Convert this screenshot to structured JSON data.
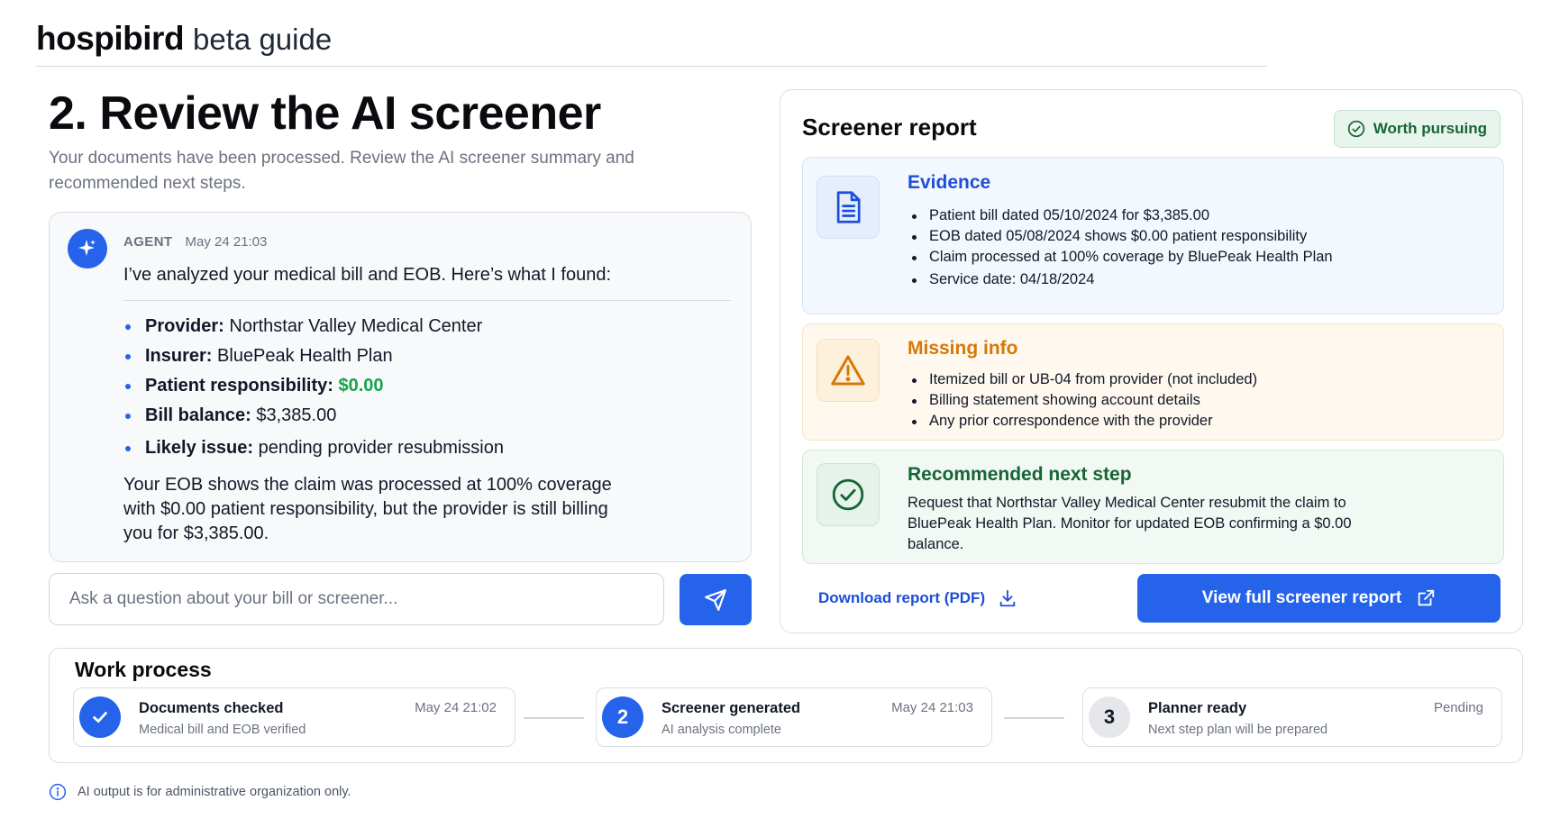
{
  "header": {
    "brand": "hospibird",
    "subtitle": "beta guide"
  },
  "page": {
    "title": "2. Review the AI screener",
    "subtitle": "Your documents have been processed. Review the AI screener summary and recommended next steps."
  },
  "agent": {
    "role": "AGENT",
    "time": "May 24 21:03",
    "intro": "I’ve analyzed your medical bill and EOB. Here’s what I found:",
    "items": [
      {
        "label": "Provider:",
        "value": "Northstar Valley Medical Center"
      },
      {
        "label": "Insurer:",
        "value": "BluePeak Health Plan"
      },
      {
        "label": "Patient responsibility:",
        "value": "$0.00"
      },
      {
        "label": "Bill balance:",
        "value": "$3,385.00"
      },
      {
        "label": "Likely issue:",
        "value": "pending provider resubmission"
      }
    ],
    "summary": "Your EOB shows the claim was processed at 100% coverage with $0.00 patient responsibility, but the provider is still billing you for $3,385.00."
  },
  "ask": {
    "placeholder": "Ask a question about your bill or screener..."
  },
  "report": {
    "title": "Screener report",
    "badge": "Worth pursuing",
    "evidence": {
      "heading": "Evidence",
      "items": [
        "Patient bill dated 05/10/2024 for $3,385.00",
        "EOB dated 05/08/2024 shows $0.00 patient responsibility",
        "Claim processed at 100% coverage by BluePeak Health Plan",
        "Service date: 04/18/2024"
      ]
    },
    "missing": {
      "heading": "Missing info",
      "items": [
        "Itemized bill or UB-04 from provider (not included)",
        "Billing statement showing account details",
        "Any prior correspondence with the provider"
      ]
    },
    "next_step": {
      "heading": "Recommended next step",
      "text": "Request that Northstar Valley Medical Center resubmit the claim to BluePeak Health Plan. Monitor for updated EOB confirming a $0.00 balance."
    },
    "download_label": "Download report (PDF)",
    "view_label": "View full screener report"
  },
  "work": {
    "title": "Work process",
    "steps": [
      {
        "number": "",
        "name": "Documents checked",
        "desc": "Medical bill and EOB verified",
        "time": "May 24 21:02",
        "status": "done"
      },
      {
        "number": "2",
        "name": "Screener generated",
        "desc": "AI analysis complete",
        "time": "May 24 21:03",
        "status": "active"
      },
      {
        "number": "3",
        "name": "Planner ready",
        "desc": "Next step plan will be prepared",
        "time": "Pending",
        "status": "pending"
      }
    ]
  },
  "footer": {
    "note": "AI output is for administrative organization only."
  },
  "colors": {
    "accent": "#2563eb",
    "success": "#16a34a",
    "warning": "#d97706",
    "evidence_bg": "#f3f7fe",
    "missing_bg": "#fef8ee",
    "next_bg": "#f2f8f3"
  },
  "icons": {
    "agent": "sparkle-icon",
    "send": "paper-plane-icon",
    "badge": "check-circle-icon",
    "evidence": "document-icon",
    "missing": "warning-triangle-icon",
    "next_step": "check-circle-icon",
    "download": "download-icon",
    "view": "external-link-icon",
    "footer": "info-icon"
  }
}
